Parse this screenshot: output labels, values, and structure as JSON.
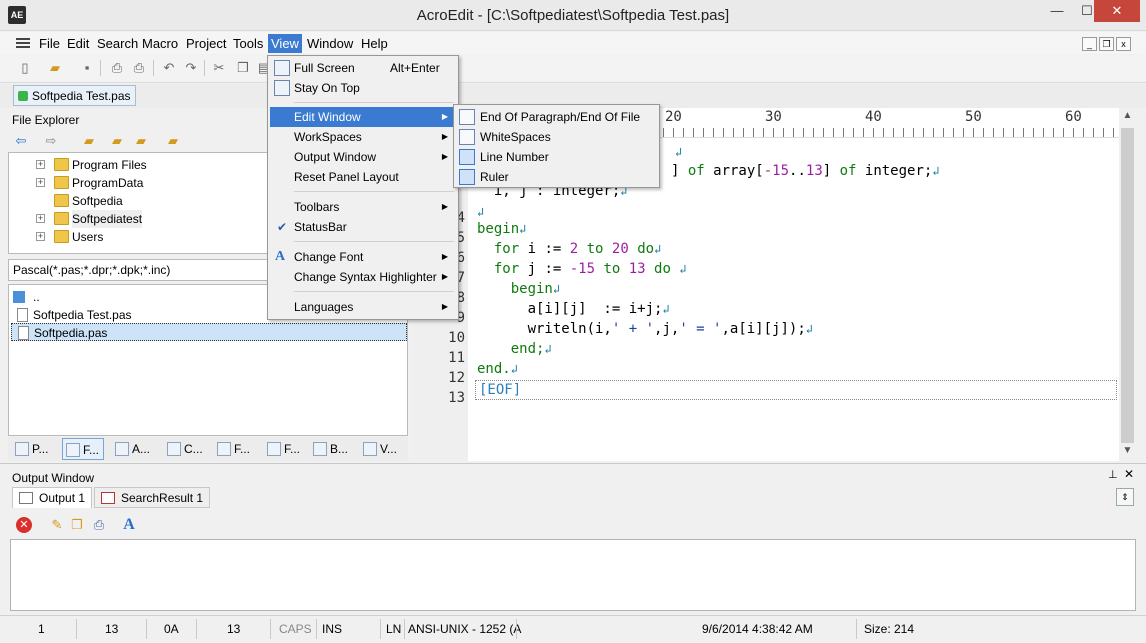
{
  "window": {
    "app_icon": "AE",
    "title": "AcroEdit - [C:\\Softpediatest\\Softpedia Test.pas]",
    "minimize": "—",
    "maximize": "☐",
    "close": "✕"
  },
  "menubar": [
    "File",
    "Edit",
    "Search",
    "Macro",
    "Project",
    "Tools",
    "View",
    "Window",
    "Help"
  ],
  "doc_tab": "Softpedia Test.pas",
  "file_explorer": {
    "title": "File Explorer",
    "tree": [
      "Program Files",
      "ProgramData",
      "Softpedia",
      "Softpediatest",
      "Users"
    ],
    "filter": "Pascal(*.pas;*.dpr;*.dpk;*.inc)",
    "files": [
      "..",
      "Softpedia Test.pas",
      "Softpedia.pas"
    ],
    "panel_tabs": [
      "P...",
      "F...",
      "A...",
      "C...",
      "F...",
      "F...",
      "B...",
      "V..."
    ]
  },
  "view_menu": {
    "full_screen": "Full Screen",
    "full_screen_accel": "Alt+Enter",
    "stay_on_top": "Stay On Top",
    "edit_window": "Edit Window",
    "workspaces": "WorkSpaces",
    "output_window": "Output Window",
    "reset_panel_layout": "Reset Panel Layout",
    "toolbars": "Toolbars",
    "statusbar": "StatusBar",
    "change_font": "Change Font",
    "change_syntax_highlighter": "Change Syntax Highlighter",
    "languages": "Languages"
  },
  "edit_window_submenu": {
    "eop": "End Of Paragraph/End Of File",
    "whitespaces": "WhiteSpaces",
    "line_number": "Line Number",
    "ruler": "Ruler"
  },
  "ruler": [
    "20",
    "30",
    "40",
    "50",
    "60"
  ],
  "line_numbers": [
    "4",
    "5",
    "6",
    "7",
    "8",
    "9",
    "10",
    "11",
    "12",
    "13"
  ],
  "code": {
    "l2a": "] ",
    "l2of1": "of",
    "l2b": " array[",
    "l2n1": "-15",
    "l2c": "..",
    "l2n2": "13",
    "l2d": "] ",
    "l2of2": "of",
    "l2e": " integer;",
    "l3": "  i, j : integer;",
    "l5": "begin",
    "l6for": "  for",
    "l6a": " i := ",
    "l6n1": "2",
    "l6to": " to",
    "l6n2": " 20",
    "l6do": " do",
    "l7for": "  for",
    "l7a": " j := ",
    "l7n1": "-15",
    "l7to": " to",
    "l7n2": " 13",
    "l7do": " do ",
    "l8": "    begin",
    "l9": "      a[i][j]  := i+j;",
    "l10a": "      writeln(i,",
    "l10s1": "' + '",
    "l10b": ",j,",
    "l10s2": "' = '",
    "l10c": ",a[i][j]);",
    "l11": "    end;",
    "l12": "end.",
    "eof": "[EOF]",
    "eol_mark": "↲"
  },
  "output": {
    "title": "Output Window",
    "tabs": [
      "Output 1",
      "SearchResult 1"
    ]
  },
  "statusbar": {
    "line": "1",
    "col": "13",
    "hex": "0A",
    "dec": "13",
    "caps": "CAPS",
    "ins": "INS",
    "ln": "LN",
    "encoding": "ANSI-UNIX - 1252  (A",
    "datetime": "9/6/2014 4:38:42 AM",
    "size": "Size: 214"
  },
  "colors": {
    "menu_highlight": "#3a7ad1",
    "keyword": "#0f7b0f",
    "number": "#9c1fa3",
    "string": "#1b3fa0"
  }
}
